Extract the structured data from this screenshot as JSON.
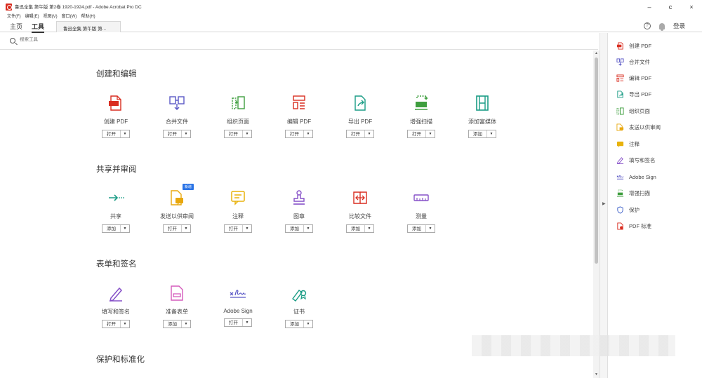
{
  "window": {
    "title": "鲁迅全集 第午版 第2卷 1920-1924.pdf - Adobe Acrobat Pro DC",
    "menu": [
      "文件(F)",
      "编辑(E)",
      "视图(V)",
      "窗口(W)",
      "帮助(H)"
    ],
    "controls": {
      "minimize": "–",
      "restore": "c",
      "close": "×"
    }
  },
  "tabs": {
    "home": "主页",
    "tools": "工具",
    "document": "鲁迅全集 第午版 第..."
  },
  "header_right": {
    "help": "?",
    "login": "登录"
  },
  "search": {
    "placeholder": "搜索工具"
  },
  "sections": [
    {
      "title": "创建和编辑"
    },
    {
      "title": "共享并审阅"
    },
    {
      "title": "表单和签名"
    },
    {
      "title": "保护和标准化"
    }
  ],
  "tools": {
    "create_pdf": {
      "label": "创建 PDF",
      "button": "打开",
      "arrow": "▼"
    },
    "combine": {
      "label": "合并文件",
      "button": "打开",
      "arrow": "▼"
    },
    "organize": {
      "label": "组织页面",
      "button": "打开",
      "arrow": "▼"
    },
    "edit_pdf": {
      "label": "编辑 PDF",
      "button": "打开",
      "arrow": "▼"
    },
    "export_pdf": {
      "label": "导出 PDF",
      "button": "打开",
      "arrow": "▼"
    },
    "scan": {
      "label": "增强扫描",
      "button": "打开",
      "arrow": "▼"
    },
    "rich_media": {
      "label": "添加富媒体",
      "button": "添加",
      "arrow": "▼"
    },
    "share": {
      "label": "共享",
      "button": "添加",
      "arrow": "▼"
    },
    "send_review": {
      "label": "发送以供审阅",
      "button": "打开",
      "arrow": "▼",
      "badge": "新增"
    },
    "comment": {
      "label": "注释",
      "button": "打开",
      "arrow": "▼"
    },
    "stamp": {
      "label": "图章",
      "button": "添加",
      "arrow": "▼"
    },
    "compare": {
      "label": "比较文件",
      "button": "添加",
      "arrow": "▼"
    },
    "measure": {
      "label": "测量",
      "button": "添加",
      "arrow": "▼"
    },
    "fill_sign": {
      "label": "填写和签名",
      "button": "打开",
      "arrow": "▼"
    },
    "prepare_form": {
      "label": "准备表单",
      "button": "添加",
      "arrow": "▼"
    },
    "adobe_sign": {
      "label": "Adobe Sign",
      "button": "打开",
      "arrow": "▼"
    },
    "certificates": {
      "label": "证书",
      "button": "添加",
      "arrow": "▼"
    }
  },
  "right_panel": [
    {
      "label": "创建 PDF",
      "icon": "create-pdf-icon",
      "color": "#d92d20"
    },
    {
      "label": "合并文件",
      "icon": "combine-files-icon",
      "color": "#5a58c6"
    },
    {
      "label": "编辑 PDF",
      "icon": "edit-pdf-icon",
      "color": "#d92d20"
    },
    {
      "label": "导出 PDF",
      "icon": "export-pdf-icon",
      "color": "#1a9c85"
    },
    {
      "label": "组织页面",
      "icon": "organize-pages-icon",
      "color": "#3e9e3e"
    },
    {
      "label": "发送以供审阅",
      "icon": "send-review-icon",
      "color": "#e8a70c"
    },
    {
      "label": "注释",
      "icon": "comment-icon",
      "color": "#e8b20c"
    },
    {
      "label": "填写和签名",
      "icon": "fill-sign-icon",
      "color": "#8650c8"
    },
    {
      "label": "Adobe Sign",
      "icon": "adobe-sign-icon",
      "color": "#5a58c6"
    },
    {
      "label": "增强扫描",
      "icon": "scan-icon",
      "color": "#3e9e3e"
    },
    {
      "label": "保护",
      "icon": "protect-icon",
      "color": "#3a5ec8"
    },
    {
      "label": "PDF 标准",
      "icon": "pdf-standards-icon",
      "color": "#d92d20"
    }
  ],
  "colors": {
    "red": "#d92d20",
    "purple": "#8650c8",
    "indigo": "#5a58c6",
    "green": "#3e9e3e",
    "teal": "#1a9c85",
    "yellow": "#e8b20c",
    "badge_blue": "#2b74e6"
  }
}
